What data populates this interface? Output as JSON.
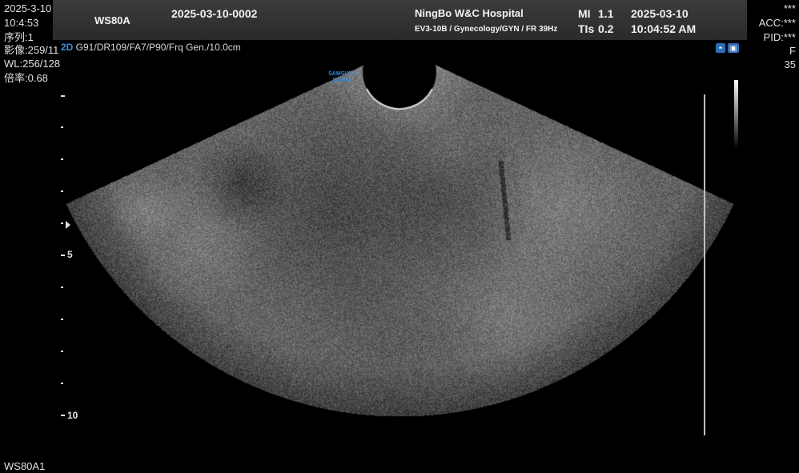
{
  "header": {
    "device": "WS80A",
    "patient_id": "2025-03-10-0002",
    "hospital": "NingBo W&C Hospital",
    "probe_info": "EV3-10B / Gynecology/GYN / FR 39Hz",
    "mi_label": "MI",
    "mi_value": "1.1",
    "tis_label": "TIs",
    "tis_value": "0.2",
    "date": "2025-03-10",
    "time": "10:04:52 AM"
  },
  "left_info": {
    "date": "2025-3-10",
    "time": "10:4:53",
    "series": "序列:1",
    "image": "影像:259/11",
    "wl": "WL:256/128",
    "zoom": "倍率:0.68"
  },
  "right_info": {
    "line1": "***",
    "acc": "ACC:***",
    "pid": "PID:***",
    "sex": "F",
    "age": "35"
  },
  "mode_line": {
    "mode": "2D",
    "params": " G91/DR109/FA7/P90/Frq Gen./10.0cm"
  },
  "logo": {
    "line1": "SAMSUNG",
    "line2": "WS80A"
  },
  "depth_scale": {
    "label_5": "5",
    "label_10": "10"
  },
  "footer": {
    "device": "WS80A1"
  },
  "icons": {
    "left": "body-mark-icon",
    "right": "mode-icon"
  }
}
